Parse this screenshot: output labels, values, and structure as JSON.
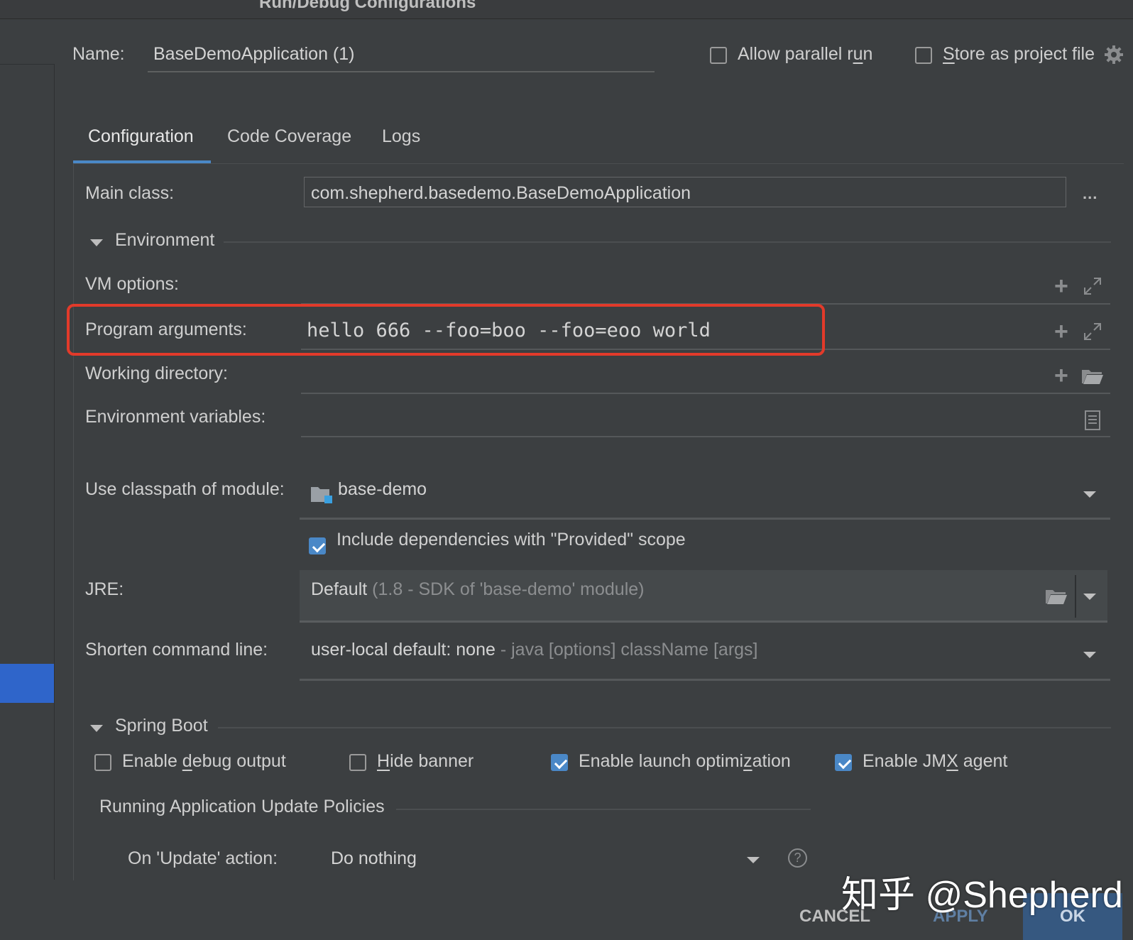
{
  "window": {
    "title": "Run/Debug Configurations"
  },
  "header": {
    "name_label": "Name:",
    "name_value": "BaseDemoApplication (1)",
    "allow_parallel_run": {
      "label_pre": "Allow parallel r",
      "label_u": "u",
      "label_post": "n",
      "checked": false
    },
    "store_as_project_file": {
      "label_pre": "",
      "label_u": "S",
      "label_post": "tore as project file",
      "checked": false
    }
  },
  "tabs": [
    {
      "label": "Configuration",
      "active": true
    },
    {
      "label": "Code Coverage",
      "active": false
    },
    {
      "label": "Logs",
      "active": false
    }
  ],
  "configuration": {
    "main_class_label": "Main class:",
    "main_class_value": "com.shepherd.basedemo.BaseDemoApplication",
    "main_class_browse": "...",
    "environment_header": "Environment",
    "vm_options_label": "VM options:",
    "vm_options_value": "",
    "program_arguments_label": "Program arguments:",
    "program_arguments_value": "hello 666 --foo=boo --foo=eoo world",
    "working_directory_label": "Working directory:",
    "working_directory_value": "",
    "env_vars_label": "Environment variables:",
    "env_vars_value": "",
    "classpath_label": "Use classpath of module:",
    "classpath_value": "base-demo",
    "include_provided": {
      "label": "Include dependencies with \"Provided\" scope",
      "checked": true
    },
    "jre_label": "JRE:",
    "jre_value": "Default",
    "jre_detail": "(1.8 - SDK of 'base-demo' module)",
    "shorten_label": "Shorten command line:",
    "shorten_value": "user-local default: none",
    "shorten_detail": "- java [options] className [args]"
  },
  "spring_boot": {
    "header": "Spring Boot",
    "enable_debug_output": {
      "label_pre": "Enable ",
      "label_u": "d",
      "label_post": "ebug output",
      "checked": false
    },
    "hide_banner": {
      "label_pre": "",
      "label_u": "H",
      "label_post": "ide banner",
      "checked": false
    },
    "enable_launch_optimization": {
      "label_pre": "Enable launch optimi",
      "label_u": "z",
      "label_post": "ation",
      "checked": true
    },
    "enable_jmx_agent": {
      "label_pre": "Enable JM",
      "label_u": "X",
      "label_post": " agent",
      "checked": true
    },
    "update_policies_header": "Running Application Update Policies",
    "on_update_label": "On 'Update' action:",
    "on_update_value": "Do nothing",
    "help_glyph": "?"
  },
  "footer": {
    "cancel": "CANCEL",
    "apply": "APPLY",
    "ok": "OK"
  },
  "watermark": "知乎 @Shepherd",
  "colors": {
    "background": "#3c3f41",
    "accent": "#4a88c7",
    "highlight_border": "#e23a2a",
    "ok_button": "#365880"
  }
}
